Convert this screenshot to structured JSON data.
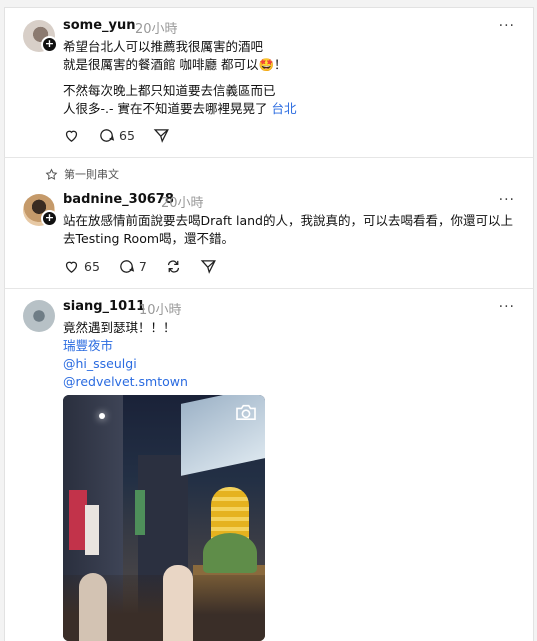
{
  "posts": [
    {
      "username": "some_yun",
      "time": "20小時",
      "lines": [
        "希望台北人可以推薦我很厲害的酒吧",
        "就是很厲害的餐酒館 咖啡廳 都可以🤩！",
        "",
        "不然每次晚上都只知道要去信義區而已",
        "人很多-.- 實在不知道要去哪裡晃晃了"
      ],
      "tag": "台北",
      "replies": "65"
    },
    {
      "thread_label": "第一則串文",
      "username": "badnine_30678",
      "time": "20小時",
      "lines": [
        "站在放感情前面說要去喝Draft land的人，我說真的，可以去喝看看，你還可以上",
        "去Testing Room喝，還不錯。"
      ],
      "likes": "65",
      "replies": "7"
    },
    {
      "username": "siang_1011",
      "time": "10小時",
      "lines": [
        "竟然遇到瑟琪！！！"
      ],
      "links": [
        "瑞豐夜市",
        "@hi_sseulgi",
        "@redvelvet.smtown"
      ]
    }
  ],
  "more_label": "···",
  "plus_label": "+",
  "colors": {
    "link": "#2a6be0",
    "time": "#999999"
  },
  "icons": [
    "heart-icon",
    "comment-icon",
    "repost-icon",
    "share-icon",
    "star-icon",
    "camera-icon"
  ]
}
